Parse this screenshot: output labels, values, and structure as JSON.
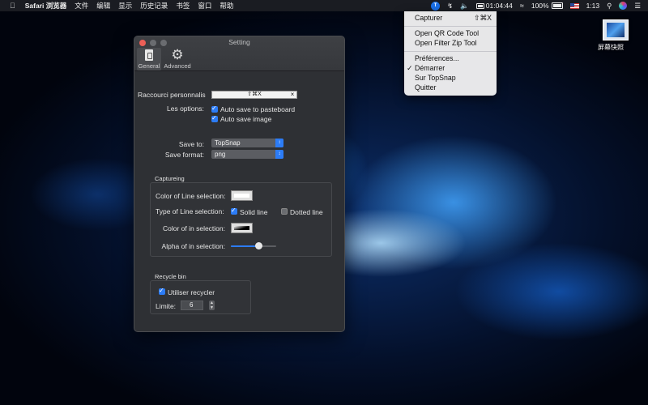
{
  "menubar": {
    "app_name": "Safari 浏览器",
    "menus": [
      "文件",
      "编辑",
      "显示",
      "历史记录",
      "书签",
      "窗口",
      "帮助"
    ],
    "status": {
      "topsnap_icon": "T",
      "clock_app": "01:04:44",
      "battery": "100%",
      "time": "1:13"
    }
  },
  "dropdown": {
    "capture_label": "Capturer",
    "capture_shortcut": "⇧⌘X",
    "qr_label": "Open QR Code Tool",
    "zip_label": "Open Filter Zip Tool",
    "prefs_label": "Préférences...",
    "start_label": "Démarrer",
    "start_checked": true,
    "about_label": "Sur TopSnap",
    "quit_label": "Quitter"
  },
  "desktop": {
    "icon_label": "屏幕快照"
  },
  "window": {
    "title": "Setting",
    "tabs": {
      "general": "General",
      "advanced": "Advanced"
    },
    "shortcut_label": "Raccourci personnalis",
    "shortcut_value": "⇧⌘X",
    "clear_glyph": "×",
    "options_label": "Les options:",
    "opt_pasteboard": "Auto save to pasteboard",
    "opt_image": "Auto save image",
    "save_to_label": "Save to:",
    "save_to_value": "TopSnap",
    "format_label": "Save format:",
    "format_value": "png",
    "captureing": {
      "title": "Captureing",
      "line_color_label": "Color of Line selection:",
      "line_type_label": "Type of Line selection:",
      "solid_label": "Solid line",
      "dotted_label": "Dotted line",
      "in_color_label": "Color of in selection:",
      "alpha_label": "Alpha of in selection:",
      "alpha_value": 0.6,
      "line_color": "#ffffff"
    },
    "recycle": {
      "title": "Recycle bin",
      "use_label": "Utiliser recycler",
      "limit_label": "Limite:",
      "limit_value": "6"
    }
  }
}
